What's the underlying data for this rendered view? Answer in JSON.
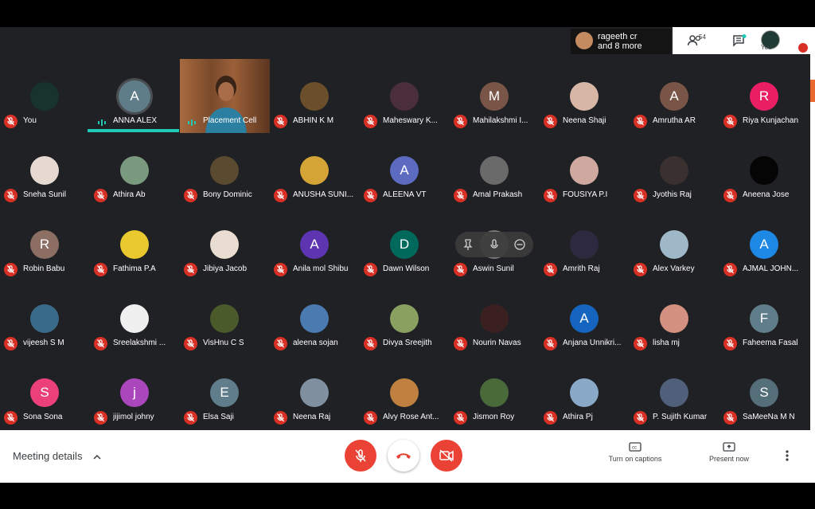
{
  "header": {
    "presenters_text": "rageeth cr\nand 8 more",
    "people_count": "54",
    "you_label": "You"
  },
  "participants": [
    {
      "name": "You",
      "avatar_type": "image",
      "color": "#17332c"
    },
    {
      "name": "ANNA ALEX",
      "avatar_type": "letter",
      "letter": "A",
      "color": "#5f7d88",
      "speaking": true
    },
    {
      "name": "Placement Cell",
      "avatar_type": "video",
      "speaking": true
    },
    {
      "name": "ABHIN K M",
      "avatar_type": "image",
      "color": "#6b4f2a"
    },
    {
      "name": "Maheswary K...",
      "avatar_type": "image",
      "color": "#4a2e3c"
    },
    {
      "name": "Mahilakshmi I...",
      "avatar_type": "letter",
      "letter": "M",
      "color": "#795548"
    },
    {
      "name": "Neena Shaji",
      "avatar_type": "image",
      "color": "#d8b6a6"
    },
    {
      "name": "Amrutha AR",
      "avatar_type": "letter",
      "letter": "A",
      "color": "#795548"
    },
    {
      "name": "Riya Kunjachan",
      "avatar_type": "letter",
      "letter": "R",
      "color": "#e91e63"
    },
    {
      "name": "Sneha Sunil",
      "avatar_type": "image",
      "color": "#e6d9d2"
    },
    {
      "name": "Athira Ab",
      "avatar_type": "image",
      "color": "#7a9a80"
    },
    {
      "name": "Bony Dominic",
      "avatar_type": "image",
      "color": "#5a4a30"
    },
    {
      "name": "ANUSHA SUNI...",
      "avatar_type": "image",
      "color": "#d4a536"
    },
    {
      "name": "ALEENA VT",
      "avatar_type": "letter",
      "letter": "A",
      "color": "#5c6bc0"
    },
    {
      "name": "Amal Prakash",
      "avatar_type": "image",
      "color": "#6a6a6a"
    },
    {
      "name": "FOUSIYA P.I",
      "avatar_type": "image",
      "color": "#cfa9a0"
    },
    {
      "name": "Jyothis Raj",
      "avatar_type": "image",
      "color": "#3a3030"
    },
    {
      "name": "Aneena Jose",
      "avatar_type": "image",
      "color": "#050505"
    },
    {
      "name": "Robin Babu",
      "avatar_type": "letter",
      "letter": "R",
      "color": "#8d6e63"
    },
    {
      "name": "Fathima P.A",
      "avatar_type": "image",
      "color": "#e9c92e"
    },
    {
      "name": "Jibiya Jacob",
      "avatar_type": "image",
      "color": "#e8ddd0"
    },
    {
      "name": "Anila mol Shibu",
      "avatar_type": "letter",
      "letter": "A",
      "color": "#5e35b1"
    },
    {
      "name": "Dawn Wilson",
      "avatar_type": "letter",
      "letter": "D",
      "color": "#00695c"
    },
    {
      "name": "Aswin Sunil",
      "avatar_type": "image",
      "color": "#7a7a7a",
      "hovered": true
    },
    {
      "name": "Amrith Raj",
      "avatar_type": "image",
      "color": "#2d2a40"
    },
    {
      "name": "Alex Varkey",
      "avatar_type": "image",
      "color": "#9fb8c8"
    },
    {
      "name": "AJMAL JOHN...",
      "avatar_type": "letter",
      "letter": "A",
      "color": "#1e88e5"
    },
    {
      "name": "vijeesh S M",
      "avatar_type": "image",
      "color": "#3a6a8a"
    },
    {
      "name": "Sreelakshmi ...",
      "avatar_type": "image",
      "color": "#f0f0f0"
    },
    {
      "name": "VisHnu C S",
      "avatar_type": "image",
      "color": "#4a5a2a"
    },
    {
      "name": "aleena sojan",
      "avatar_type": "image",
      "color": "#4a7ab0"
    },
    {
      "name": "Divya Sreejith",
      "avatar_type": "image",
      "color": "#8aa060"
    },
    {
      "name": "Nourin Navas",
      "avatar_type": "image",
      "color": "#3a2020"
    },
    {
      "name": "Anjana Unnikri...",
      "avatar_type": "letter",
      "letter": "A",
      "color": "#1565c0"
    },
    {
      "name": "lisha mj",
      "avatar_type": "image",
      "color": "#d49080"
    },
    {
      "name": "Faheema Fasal",
      "avatar_type": "letter",
      "letter": "F",
      "color": "#607d8b"
    },
    {
      "name": "Sona Sona",
      "avatar_type": "letter",
      "letter": "S",
      "color": "#ec407a"
    },
    {
      "name": "jijimol johny",
      "avatar_type": "letter",
      "letter": "j",
      "color": "#ab47bc"
    },
    {
      "name": "Elsa Saji",
      "avatar_type": "letter",
      "letter": "E",
      "color": "#607d8b"
    },
    {
      "name": "Neena Raj",
      "avatar_type": "image",
      "color": "#8090a0"
    },
    {
      "name": "Alvy Rose Ant...",
      "avatar_type": "image",
      "color": "#c08040"
    },
    {
      "name": "Jismon Roy",
      "avatar_type": "image",
      "color": "#4a6a3a"
    },
    {
      "name": "Athira Pj",
      "avatar_type": "image",
      "color": "#8aa8c8"
    },
    {
      "name": "P. Sujith Kumar",
      "avatar_type": "image",
      "color": "#50607a"
    },
    {
      "name": "SaMeeNa M N",
      "avatar_type": "letter",
      "letter": "S",
      "color": "#546e7a"
    }
  ],
  "bottom": {
    "meeting_details": "Meeting details",
    "captions_label": "Turn on captions",
    "present_label": "Present now"
  },
  "colors": {
    "muted": "#d93025",
    "end_call": "#ea4335",
    "speaking": "#1fc9b4"
  },
  "icons": {
    "people": "people-icon",
    "chat": "chat-icon",
    "mic_off": "mic-off-icon",
    "cam_off": "camera-off-icon",
    "hangup": "hangup-icon",
    "captions": "captions-icon",
    "present": "present-icon",
    "more": "more-vert-icon"
  }
}
